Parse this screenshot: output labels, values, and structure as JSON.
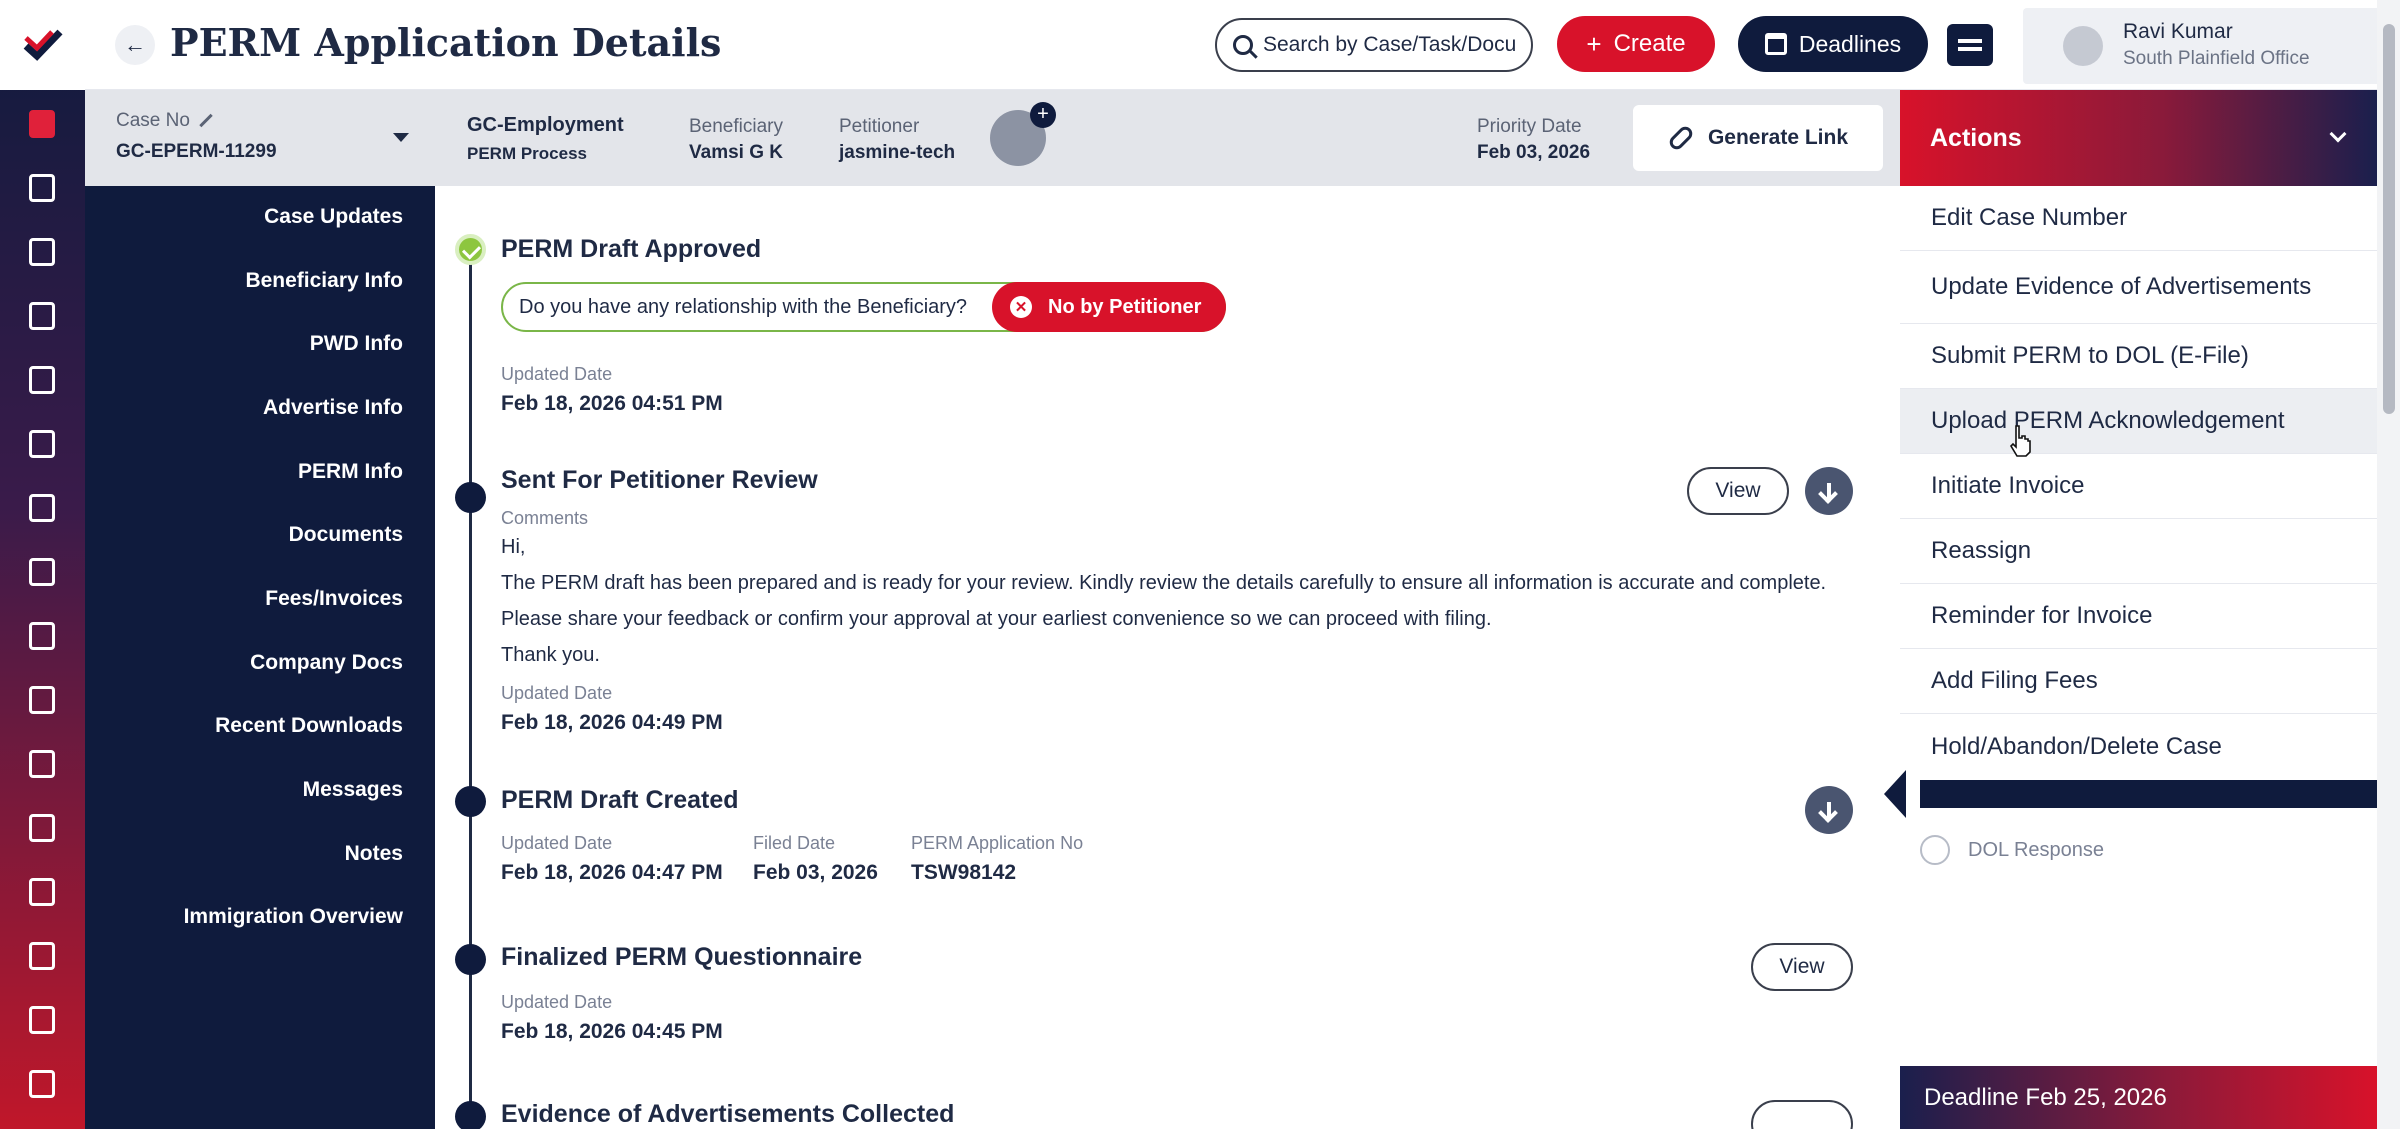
{
  "header": {
    "title": "PERM Application Details",
    "search_placeholder": "Search by Case/Task/Docu",
    "create_label": "Create",
    "deadlines_label": "Deadlines",
    "user_name": "Ravi Kumar",
    "user_office": "South Plainfield Office"
  },
  "case": {
    "case_no_label": "Case No",
    "case_no": "GC-EPERM-11299",
    "type": "GC-Employment",
    "process": "PERM Process",
    "beneficiary_label": "Beneficiary",
    "beneficiary": "Vamsi G K",
    "petitioner_label": "Petitioner",
    "petitioner": "jasmine-tech",
    "priority_label": "Priority Date",
    "priority_date": "Feb 03, 2026",
    "generate_link_label": "Generate Link"
  },
  "sections": [
    "Case Updates",
    "Beneficiary Info",
    "PWD Info",
    "Advertise Info",
    "PERM Info",
    "Documents",
    "Fees/Invoices",
    "Company Docs",
    "Recent Downloads",
    "Messages",
    "Notes",
    "Immigration Overview"
  ],
  "timeline": {
    "approved": {
      "title": "PERM Draft Approved",
      "question": "Do you have any relationship with the Beneficiary?",
      "answer": "No by Petitioner",
      "updated_label": "Updated Date",
      "updated": "Feb 18, 2026 04:51 PM"
    },
    "review": {
      "title": "Sent For Petitioner Review",
      "comments_label": "Comments",
      "line1": "Hi,",
      "line2": "The PERM draft has been prepared and is ready for your review. Kindly review the details carefully to ensure all information is accurate and complete.",
      "line3": "Please share your feedback or confirm your approval at your earliest convenience so we can proceed with filing.",
      "line4": "Thank you.",
      "updated_label": "Updated Date",
      "updated": "Feb 18, 2026 04:49 PM",
      "view_label": "View"
    },
    "created": {
      "title": "PERM Draft Created",
      "updated_label": "Updated Date",
      "updated": "Feb 18, 2026 04:47 PM",
      "filed_label": "Filed Date",
      "filed": "Feb 03, 2026",
      "appno_label": "PERM Application No",
      "appno": "TSW98142"
    },
    "questionnaire": {
      "title": "Finalized PERM Questionnaire",
      "updated_label": "Updated Date",
      "updated": "Feb 18, 2026 04:45 PM",
      "view_label": "View"
    },
    "evidence": {
      "title": "Evidence of Advertisements Collected"
    }
  },
  "actions": {
    "title": "Actions",
    "items": [
      "Edit Case Number",
      "Update Evidence of Advertisements",
      "Submit PERM to DOL (E-File)",
      "Upload PERM Acknowledgement",
      "Initiate Invoice",
      "Reassign",
      "Reminder for Invoice",
      "Add Filing Fees",
      "Hold/Abandon/Delete Case"
    ],
    "dol_response": "DOL Response",
    "deadline": "Deadline Feb 25, 2026"
  }
}
